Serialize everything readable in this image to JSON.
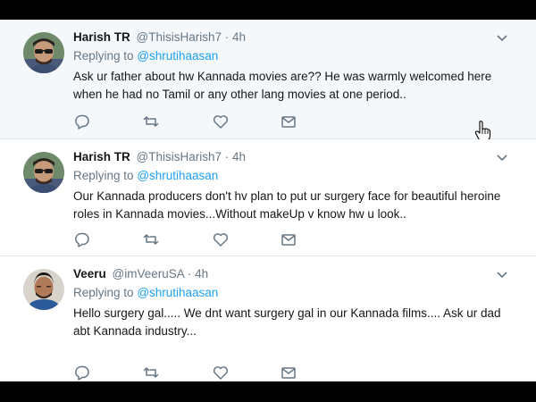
{
  "tweets": [
    {
      "name": "Harish TR",
      "handle": "@ThisisHarish7",
      "separator": "·",
      "time": "4h",
      "replying_label": "Replying to",
      "mention": "@shrutihaasan",
      "text": "Ask ur father about hw Kannada movies are?? He was warmly welcomed here when he had no Tamil or any other lang movies at one period..",
      "highlighted": true
    },
    {
      "name": "Harish TR",
      "handle": "@ThisisHarish7",
      "separator": "·",
      "time": "4h",
      "replying_label": "Replying to",
      "mention": "@shrutihaasan",
      "text": "Our Kannada producers don't hv plan to put ur surgery face for beautiful heroine roles in Kannada movies...Without makeUp v know hw u look..",
      "highlighted": false
    },
    {
      "name": "Veeru",
      "handle": "@imVeeruSA",
      "separator": "·",
      "time": "4h",
      "replying_label": "Replying to",
      "mention": "@shrutihaasan",
      "text": "Hello surgery gal..... We dnt want surgery gal in our Kannada films.... Ask ur dad abt Kannada industry...",
      "highlighted": false
    }
  ],
  "icons": {
    "reply": "reply-icon",
    "retweet": "retweet-icon",
    "like": "like-icon",
    "dm": "direct-message-icon",
    "more": "chevron-down-icon",
    "cursor": "hand-cursor-icon"
  },
  "colors": {
    "highlight_bg": "#f5f8fa",
    "mention": "#1da1f2",
    "muted": "#657786",
    "text": "#14171a",
    "icon": "#657786"
  }
}
